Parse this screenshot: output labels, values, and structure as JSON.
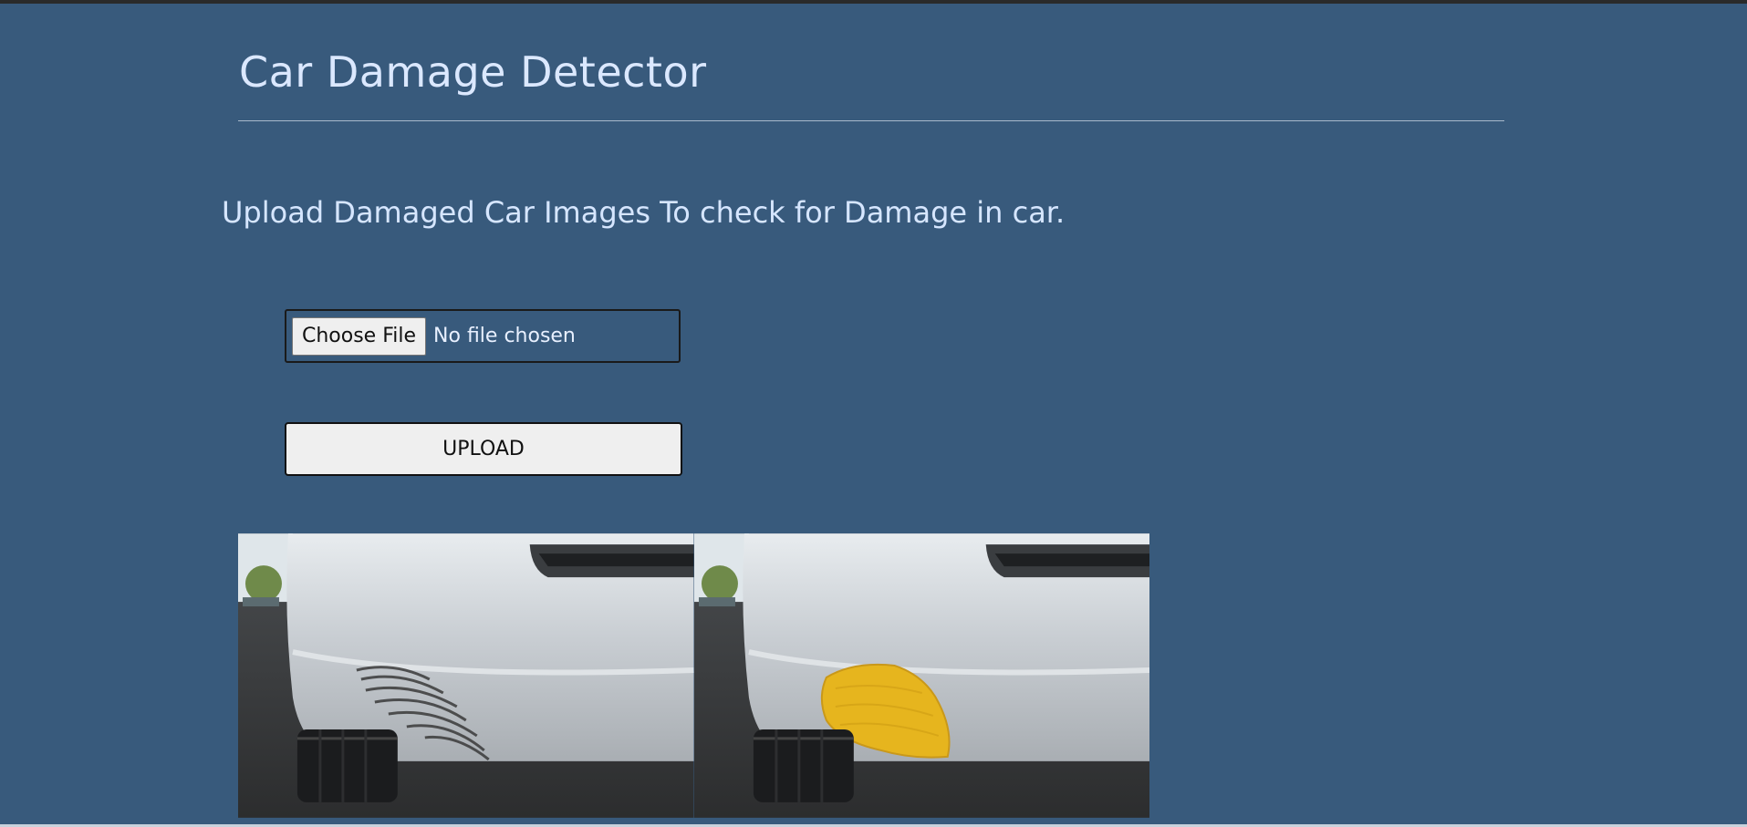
{
  "header": {
    "title": "Car Damage Detector"
  },
  "intro_text": "Upload Damaged Car Images To check for Damage in car.",
  "file_input": {
    "button_label": "Choose File",
    "status": "No file chosen"
  },
  "upload_button": {
    "label": "UPLOAD"
  },
  "images": [
    {
      "name": "original-car-image"
    },
    {
      "name": "damage-highlighted-car-image",
      "highlight_color": "#e6b51e"
    }
  ],
  "colors": {
    "background": "#385a7c",
    "title": "#dbe8ff",
    "highlight": "#e6b51e"
  }
}
